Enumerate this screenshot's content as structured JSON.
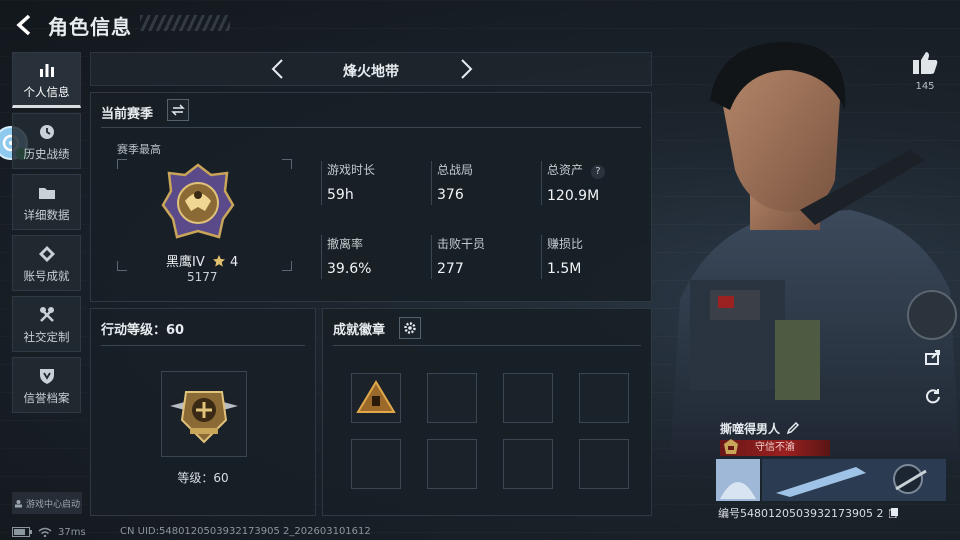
{
  "page_title": "角色信息",
  "nav": [
    {
      "label": "个人信息",
      "icon": "bar-chart-icon",
      "active": true
    },
    {
      "label": "历史战绩",
      "icon": "clock-icon",
      "active": false
    },
    {
      "label": "详细数据",
      "icon": "folder-icon",
      "active": false
    },
    {
      "label": "账号成就",
      "icon": "diamond-icon",
      "active": false
    },
    {
      "label": "社交定制",
      "icon": "tools-icon",
      "active": false
    },
    {
      "label": "信誉档案",
      "icon": "shield-icon",
      "active": false
    }
  ],
  "nav_footer": "游戏中心启动",
  "mode": {
    "title": "烽火地带"
  },
  "season": {
    "header": "当前赛季",
    "sub_label": "赛季最高",
    "rank_name": "黑鹰IV",
    "rank_stars": "4",
    "rank_score": "5177",
    "stats": [
      {
        "label": "游戏时长",
        "value": "59h"
      },
      {
        "label": "总战局",
        "value": "376"
      },
      {
        "label": "总资产",
        "value": "120.9M",
        "help": "?"
      },
      {
        "label": "撤离率",
        "value": "39.6%"
      },
      {
        "label": "击败干员",
        "value": "277"
      },
      {
        "label": "赚损比",
        "value": "1.5M"
      }
    ]
  },
  "action_level": {
    "header": "行动等级：60",
    "level_text": "等级：60"
  },
  "achievements": {
    "header": "成就徽章"
  },
  "likes": {
    "count": "145"
  },
  "player": {
    "name": "撕噬得男人",
    "title": "守信不渝",
    "uid_label": "编号5480120503932173905 2"
  },
  "status": {
    "ping": "37ms"
  },
  "cn_uid": "CN UID:5480120503932173905 2_202603101612",
  "colors": {
    "accent_red": "#9a2020",
    "gold": "#c9a55a",
    "panel_bg": "#181f26"
  }
}
